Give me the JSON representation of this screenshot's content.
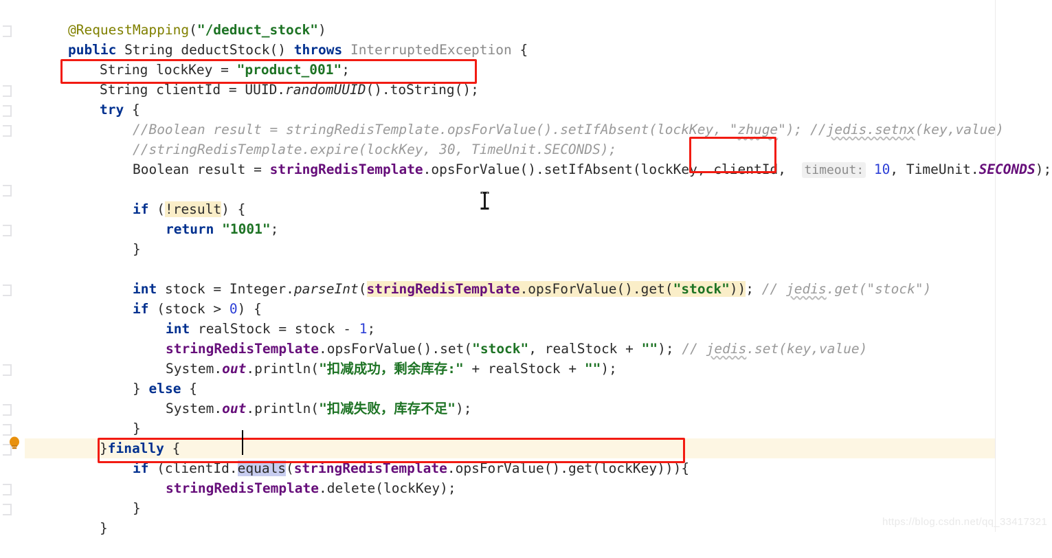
{
  "editor": {
    "language": "java",
    "font_size_px": 19.5,
    "line_height_px": 29,
    "background": "#ffffff",
    "current_line_background": "#fdf6e3",
    "identifier_highlight": "#faeec8",
    "selection_highlight": "#c8cdf0",
    "annotation_box_color": "#f21b12",
    "right_margin_guide_x": 1448
  },
  "watermark": {
    "text": "https://blog.csdn.net/qq_33417321"
  },
  "gutter": {
    "bulb_tooltip": "Show context actions"
  },
  "code": {
    "line01": {
      "annotation": "@RequestMapping",
      "paren_open": "(",
      "string": "\"/deduct_stock\"",
      "paren_close": ")"
    },
    "line02": {
      "kw_public": "public",
      "type_string": "String",
      "method": "deductStock()",
      "kw_throws": "throws",
      "exception": "InterruptedException",
      "brace": "{"
    },
    "line03": {
      "type": "String",
      "name": "lockKey",
      "eq": "=",
      "string": "\"product_001\"",
      "semi": ";"
    },
    "line04": {
      "type": "String",
      "name": "clientId",
      "eq": "=",
      "cls": "UUID.",
      "static_method": "randomUUID",
      "tail": "().toString();"
    },
    "line05": {
      "kw_try": "try",
      "brace": "{"
    },
    "line06": {
      "comment_a": "//Boolean result = stringRedisTemplate.opsForValue().setIfAbsent(lockKey, \"",
      "comment_squiggle1": "zhuge",
      "comment_b": "\"); //",
      "comment_squiggle2": "jedis.setnx",
      "comment_c": "(key,value)"
    },
    "line07": {
      "comment": "//stringRedisTemplate.expire(lockKey, 30, TimeUnit.SECONDS);"
    },
    "line08": {
      "type": "Boolean",
      "name": "result",
      "eq": "=",
      "field": "stringRedisTemplate",
      "calls": ".opsForValue().setIfAbsent(lockKey, ",
      "arg_clientId": "clientId,",
      "param_hint": "timeout:",
      "timeout_value": "10",
      "comma": ",",
      "timeunit": "TimeUnit.",
      "seconds": "SECONDS",
      "tail": ");"
    },
    "line10": {
      "kw_if": "if",
      "open": "(",
      "bang": "!",
      "ident": "result",
      "close": ")",
      "brace": "{"
    },
    "line11": {
      "kw_return": "return",
      "string": "\"1001\"",
      "semi": ";"
    },
    "line12": {
      "brace": "}"
    },
    "line14": {
      "kw_int": "int",
      "name": "stock",
      "eq": "=",
      "cls": "Integer.",
      "static_method": "parseInt",
      "open": "(",
      "field": "stringRedisTemplate",
      "calls": ".opsForValue().get(",
      "string": "\"stock\"",
      "close": "))",
      "semi": ";",
      "comment_a": "// ",
      "comment_squiggle": "jedis",
      "comment_b": ".get(\"stock\")"
    },
    "line15": {
      "kw_if": "if",
      "expr_a": "(stock > ",
      "zero": "0",
      "expr_b": ")",
      "brace": "{"
    },
    "line16": {
      "kw_int": "int",
      "name": "realStock",
      "eq": "= stock - ",
      "one": "1",
      "semi": ";"
    },
    "line17": {
      "field": "stringRedisTemplate",
      "calls": ".opsForValue().set(",
      "string1": "\"stock\"",
      "mid": ", realStock + ",
      "string2": "\"\"",
      "tail": ");",
      "comment_a": "// ",
      "comment_squiggle": "jedis",
      "comment_b": ".set(key,value)"
    },
    "line18": {
      "sysclass": "System.",
      "out": "out",
      "call": ".println(",
      "string": "\"扣减成功，剩余库存:\"",
      "mid": " + realStock + ",
      "string2": "\"\"",
      "tail": ");"
    },
    "line19": {
      "brace_close": "}",
      "kw_else": "else",
      "brace_open": "{"
    },
    "line20": {
      "sysclass": "System.",
      "out": "out",
      "call": ".println(",
      "string": "\"扣减失败，库存不足\"",
      "tail": ");"
    },
    "line21": {
      "brace": "}"
    },
    "line22": {
      "brace_close": "}",
      "kw_finally": "finally",
      "brace_open": "{"
    },
    "line23": {
      "kw_if": "if",
      "open": " (clientId.",
      "sel_a": "equa",
      "sel_b": "ls",
      "open2": "(",
      "field": "stringRedisTemplate",
      "calls": ".opsForValue().get(lockKey)))",
      "brace": "{"
    },
    "line24": {
      "field": "stringRedisTemplate",
      "calls": ".delete(lockKey);"
    },
    "line25": {
      "brace": "}"
    },
    "line26": {
      "brace": "}"
    }
  }
}
